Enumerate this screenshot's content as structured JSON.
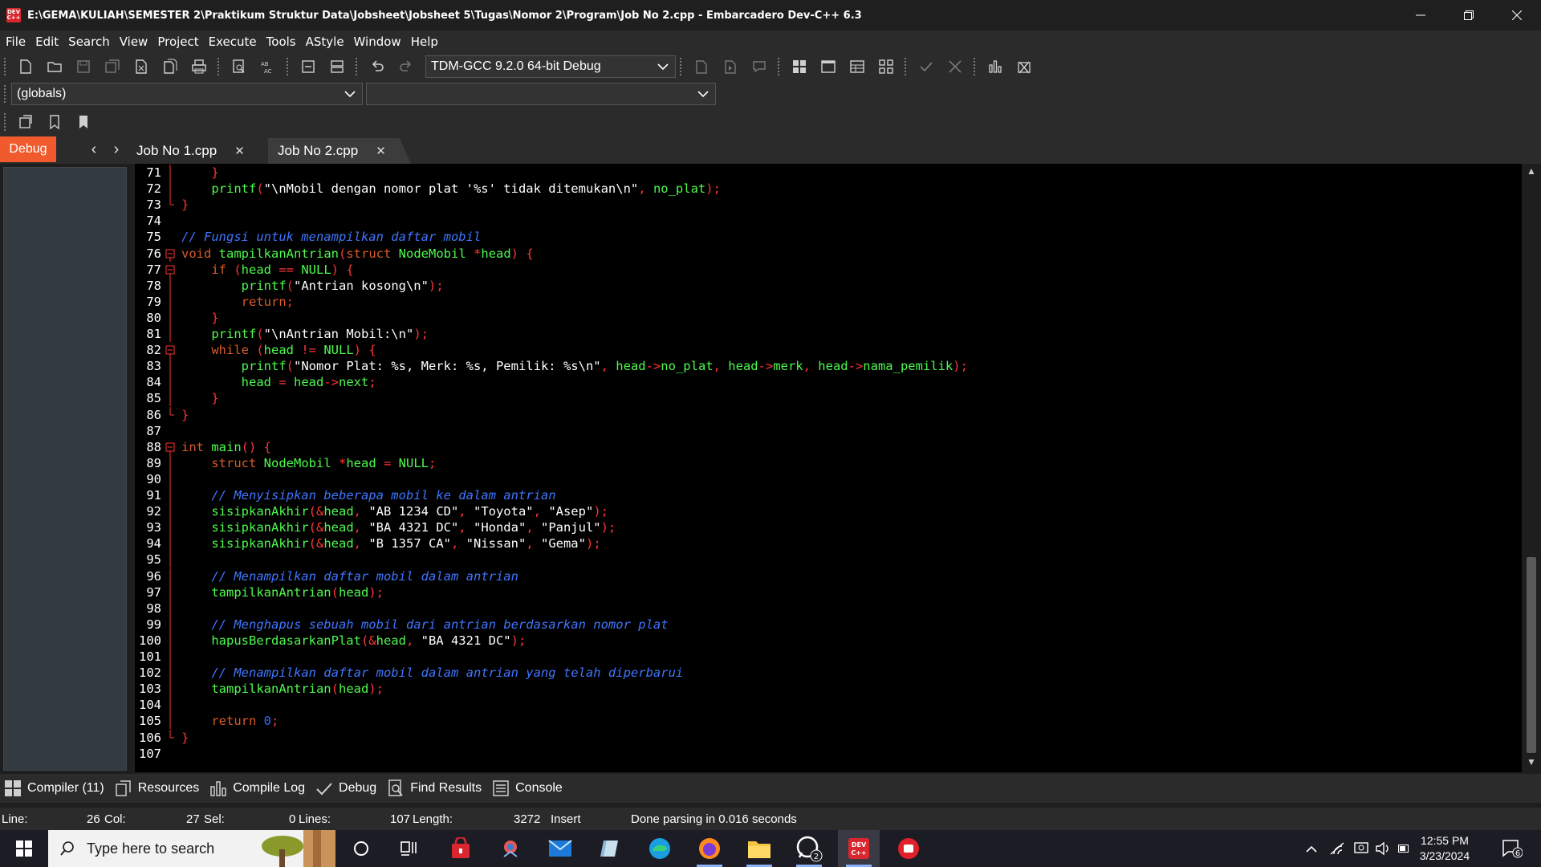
{
  "window": {
    "title": "E:\\GEMA\\KULIAH\\SEMESTER 2\\Praktikum Struktur Data\\Jobsheet\\Jobsheet 5\\Tugas\\Nomor 2\\Program\\Job No 2.cpp - Embarcadero Dev-C++ 6.3",
    "app_icon_text": "DEV C++"
  },
  "menu": [
    "File",
    "Edit",
    "Search",
    "View",
    "Project",
    "Execute",
    "Tools",
    "AStyle",
    "Window",
    "Help"
  ],
  "toolbar": {
    "compiler_select": "TDM-GCC 9.2.0 64-bit Debug",
    "scope_select": "(globals)",
    "function_select": ""
  },
  "tabs": {
    "left_panel_tab": "Debug",
    "files": [
      {
        "label": "Job No 1.cpp",
        "active": false
      },
      {
        "label": "Job No 2.cpp",
        "active": true
      }
    ]
  },
  "editor": {
    "lines": [
      {
        "n": "71",
        "fold": "line",
        "tokens": [
          [
            "    ",
            "c-txt"
          ],
          [
            "}",
            "c-sym"
          ]
        ]
      },
      {
        "n": "72",
        "fold": "line",
        "tokens": [
          [
            "    ",
            "c-txt"
          ],
          [
            "printf",
            "c-id"
          ],
          [
            "(",
            "c-sym"
          ],
          [
            "\"\\nMobil dengan nomor plat '%s' tidak ditemukan\\n\"",
            "c-str"
          ],
          [
            ", ",
            "c-sym"
          ],
          [
            "no_plat",
            "c-id"
          ],
          [
            ");",
            "c-sym"
          ]
        ]
      },
      {
        "n": "73",
        "fold": "end",
        "tokens": [
          [
            "}",
            "c-sym"
          ]
        ]
      },
      {
        "n": "74",
        "fold": "",
        "tokens": []
      },
      {
        "n": "75",
        "fold": "",
        "tokens": [
          [
            "// Fungsi untuk menampilkan daftar mobil",
            "c-cm"
          ]
        ]
      },
      {
        "n": "76",
        "fold": "box",
        "tokens": [
          [
            "void",
            "c-kw"
          ],
          [
            " ",
            "c-txt"
          ],
          [
            "tampilkanAntrian",
            "c-id"
          ],
          [
            "(",
            "c-sym"
          ],
          [
            "struct",
            "c-kw"
          ],
          [
            " ",
            "c-txt"
          ],
          [
            "NodeMobil",
            "c-id"
          ],
          [
            " *",
            "c-sym"
          ],
          [
            "head",
            "c-id"
          ],
          [
            ") {",
            "c-sym"
          ]
        ]
      },
      {
        "n": "77",
        "fold": "box",
        "tokens": [
          [
            "    ",
            "c-txt"
          ],
          [
            "if",
            "c-kw"
          ],
          [
            " (",
            "c-sym"
          ],
          [
            "head",
            "c-id"
          ],
          [
            " == ",
            "c-sym"
          ],
          [
            "NULL",
            "c-id"
          ],
          [
            ") {",
            "c-sym"
          ]
        ]
      },
      {
        "n": "78",
        "fold": "line",
        "tokens": [
          [
            "        ",
            "c-txt"
          ],
          [
            "printf",
            "c-id"
          ],
          [
            "(",
            "c-sym"
          ],
          [
            "\"Antrian kosong\\n\"",
            "c-str"
          ],
          [
            ");",
            "c-sym"
          ]
        ]
      },
      {
        "n": "79",
        "fold": "line",
        "tokens": [
          [
            "        ",
            "c-txt"
          ],
          [
            "return",
            "c-kw"
          ],
          [
            ";",
            "c-sym"
          ]
        ]
      },
      {
        "n": "80",
        "fold": "line",
        "tokens": [
          [
            "    ",
            "c-txt"
          ],
          [
            "}",
            "c-sym"
          ]
        ]
      },
      {
        "n": "81",
        "fold": "line",
        "tokens": [
          [
            "    ",
            "c-txt"
          ],
          [
            "printf",
            "c-id"
          ],
          [
            "(",
            "c-sym"
          ],
          [
            "\"\\nAntrian Mobil:\\n\"",
            "c-str"
          ],
          [
            ");",
            "c-sym"
          ]
        ]
      },
      {
        "n": "82",
        "fold": "box",
        "tokens": [
          [
            "    ",
            "c-txt"
          ],
          [
            "while",
            "c-kw"
          ],
          [
            " (",
            "c-sym"
          ],
          [
            "head",
            "c-id"
          ],
          [
            " != ",
            "c-sym"
          ],
          [
            "NULL",
            "c-id"
          ],
          [
            ") {",
            "c-sym"
          ]
        ]
      },
      {
        "n": "83",
        "fold": "line",
        "tokens": [
          [
            "        ",
            "c-txt"
          ],
          [
            "printf",
            "c-id"
          ],
          [
            "(",
            "c-sym"
          ],
          [
            "\"Nomor Plat: %s, Merk: %s, Pemilik: %s\\n\"",
            "c-str"
          ],
          [
            ", ",
            "c-sym"
          ],
          [
            "head",
            "c-id"
          ],
          [
            "->",
            "c-sym"
          ],
          [
            "no_plat",
            "c-id"
          ],
          [
            ", ",
            "c-sym"
          ],
          [
            "head",
            "c-id"
          ],
          [
            "->",
            "c-sym"
          ],
          [
            "merk",
            "c-id"
          ],
          [
            ", ",
            "c-sym"
          ],
          [
            "head",
            "c-id"
          ],
          [
            "->",
            "c-sym"
          ],
          [
            "nama_pemilik",
            "c-id"
          ],
          [
            ");",
            "c-sym"
          ]
        ]
      },
      {
        "n": "84",
        "fold": "line",
        "tokens": [
          [
            "        ",
            "c-txt"
          ],
          [
            "head",
            "c-id"
          ],
          [
            " = ",
            "c-sym"
          ],
          [
            "head",
            "c-id"
          ],
          [
            "->",
            "c-sym"
          ],
          [
            "next",
            "c-id"
          ],
          [
            ";",
            "c-sym"
          ]
        ]
      },
      {
        "n": "85",
        "fold": "line",
        "tokens": [
          [
            "    ",
            "c-txt"
          ],
          [
            "}",
            "c-sym"
          ]
        ]
      },
      {
        "n": "86",
        "fold": "end",
        "tokens": [
          [
            "}",
            "c-sym"
          ]
        ]
      },
      {
        "n": "87",
        "fold": "",
        "tokens": []
      },
      {
        "n": "88",
        "fold": "box",
        "tokens": [
          [
            "int",
            "c-kw"
          ],
          [
            " ",
            "c-txt"
          ],
          [
            "main",
            "c-id"
          ],
          [
            "() {",
            "c-sym"
          ]
        ]
      },
      {
        "n": "89",
        "fold": "line",
        "tokens": [
          [
            "    ",
            "c-txt"
          ],
          [
            "struct",
            "c-kw"
          ],
          [
            " ",
            "c-txt"
          ],
          [
            "NodeMobil",
            "c-id"
          ],
          [
            " *",
            "c-sym"
          ],
          [
            "head",
            "c-id"
          ],
          [
            " = ",
            "c-sym"
          ],
          [
            "NULL",
            "c-id"
          ],
          [
            ";",
            "c-sym"
          ]
        ]
      },
      {
        "n": "90",
        "fold": "line",
        "tokens": []
      },
      {
        "n": "91",
        "fold": "line",
        "tokens": [
          [
            "    ",
            "c-txt"
          ],
          [
            "// Menyisipkan beberapa mobil ke dalam antrian",
            "c-cm"
          ]
        ]
      },
      {
        "n": "92",
        "fold": "line",
        "tokens": [
          [
            "    ",
            "c-txt"
          ],
          [
            "sisipkanAkhir",
            "c-id"
          ],
          [
            "(&",
            "c-sym"
          ],
          [
            "head",
            "c-id"
          ],
          [
            ", ",
            "c-sym"
          ],
          [
            "\"AB 1234 CD\"",
            "c-str"
          ],
          [
            ", ",
            "c-sym"
          ],
          [
            "\"Toyota\"",
            "c-str"
          ],
          [
            ", ",
            "c-sym"
          ],
          [
            "\"Asep\"",
            "c-str"
          ],
          [
            ");",
            "c-sym"
          ]
        ]
      },
      {
        "n": "93",
        "fold": "line",
        "tokens": [
          [
            "    ",
            "c-txt"
          ],
          [
            "sisipkanAkhir",
            "c-id"
          ],
          [
            "(&",
            "c-sym"
          ],
          [
            "head",
            "c-id"
          ],
          [
            ", ",
            "c-sym"
          ],
          [
            "\"BA 4321 DC\"",
            "c-str"
          ],
          [
            ", ",
            "c-sym"
          ],
          [
            "\"Honda\"",
            "c-str"
          ],
          [
            ", ",
            "c-sym"
          ],
          [
            "\"Panjul\"",
            "c-str"
          ],
          [
            ");",
            "c-sym"
          ]
        ]
      },
      {
        "n": "94",
        "fold": "line",
        "tokens": [
          [
            "    ",
            "c-txt"
          ],
          [
            "sisipkanAkhir",
            "c-id"
          ],
          [
            "(&",
            "c-sym"
          ],
          [
            "head",
            "c-id"
          ],
          [
            ", ",
            "c-sym"
          ],
          [
            "\"B 1357 CA\"",
            "c-str"
          ],
          [
            ", ",
            "c-sym"
          ],
          [
            "\"Nissan\"",
            "c-str"
          ],
          [
            ", ",
            "c-sym"
          ],
          [
            "\"Gema\"",
            "c-str"
          ],
          [
            ");",
            "c-sym"
          ]
        ]
      },
      {
        "n": "95",
        "fold": "line",
        "tokens": []
      },
      {
        "n": "96",
        "fold": "line",
        "tokens": [
          [
            "    ",
            "c-txt"
          ],
          [
            "// Menampilkan daftar mobil dalam antrian",
            "c-cm"
          ]
        ]
      },
      {
        "n": "97",
        "fold": "line",
        "tokens": [
          [
            "    ",
            "c-txt"
          ],
          [
            "tampilkanAntrian",
            "c-id"
          ],
          [
            "(",
            "c-sym"
          ],
          [
            "head",
            "c-id"
          ],
          [
            ");",
            "c-sym"
          ]
        ]
      },
      {
        "n": "98",
        "fold": "line",
        "tokens": []
      },
      {
        "n": "99",
        "fold": "line",
        "tokens": [
          [
            "    ",
            "c-txt"
          ],
          [
            "// Menghapus sebuah mobil dari antrian berdasarkan nomor plat",
            "c-cm"
          ]
        ]
      },
      {
        "n": "100",
        "fold": "line",
        "tokens": [
          [
            "    ",
            "c-txt"
          ],
          [
            "hapusBerdasarkanPlat",
            "c-id"
          ],
          [
            "(&",
            "c-sym"
          ],
          [
            "head",
            "c-id"
          ],
          [
            ", ",
            "c-sym"
          ],
          [
            "\"BA 4321 DC\"",
            "c-str"
          ],
          [
            ");",
            "c-sym"
          ]
        ]
      },
      {
        "n": "101",
        "fold": "line",
        "tokens": []
      },
      {
        "n": "102",
        "fold": "line",
        "tokens": [
          [
            "    ",
            "c-txt"
          ],
          [
            "// Menampilkan daftar mobil dalam antrian yang telah diperbarui",
            "c-cm"
          ]
        ]
      },
      {
        "n": "103",
        "fold": "line",
        "tokens": [
          [
            "    ",
            "c-txt"
          ],
          [
            "tampilkanAntrian",
            "c-id"
          ],
          [
            "(",
            "c-sym"
          ],
          [
            "head",
            "c-id"
          ],
          [
            ");",
            "c-sym"
          ]
        ]
      },
      {
        "n": "104",
        "fold": "line",
        "tokens": []
      },
      {
        "n": "105",
        "fold": "line",
        "tokens": [
          [
            "    ",
            "c-txt"
          ],
          [
            "return",
            "c-kw"
          ],
          [
            " ",
            "c-txt"
          ],
          [
            "0",
            "c-num"
          ],
          [
            ";",
            "c-sym"
          ]
        ]
      },
      {
        "n": "106",
        "fold": "end",
        "tokens": [
          [
            "}",
            "c-sym"
          ]
        ]
      },
      {
        "n": "107",
        "fold": "",
        "tokens": []
      }
    ]
  },
  "bottom_tabs": [
    "Compiler (11)",
    "Resources",
    "Compile Log",
    "Debug",
    "Find Results",
    "Console"
  ],
  "status": {
    "line_label": "Line:",
    "line_value": "26",
    "col_label": "Col:",
    "col_value": "27",
    "sel_label": "Sel:",
    "sel_value": "0",
    "lines_label": "Lines:",
    "lines_value": "107",
    "length_label": "Length:",
    "length_value": "3272",
    "mode": "Insert",
    "message": "Done parsing in 0.016 seconds"
  },
  "taskbar": {
    "search_placeholder": "Type here to search",
    "whatsapp_badge": "2",
    "time": "12:55 PM",
    "date": "3/23/2024",
    "notification_count": "6"
  },
  "colors": {
    "accent_debug_tab": "#f15a2c",
    "editor_bg": "#000000",
    "identifier": "#4dfa4d",
    "keyword": "#d85a28",
    "comment": "#3f76ff",
    "symbol": "#ff3434"
  }
}
